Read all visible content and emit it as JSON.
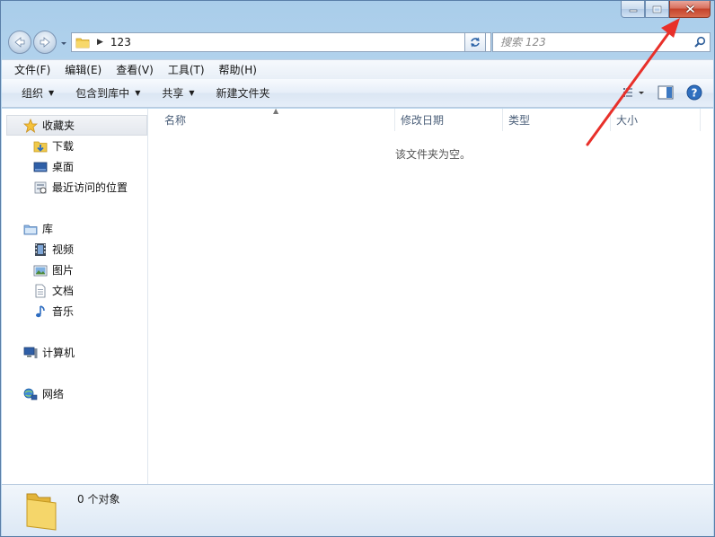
{
  "window": {
    "caption_buttons": [
      "minimize-icon",
      "maximize-icon",
      "close-icon"
    ]
  },
  "address_bar": {
    "path": "123"
  },
  "search": {
    "placeholder": "搜索 123"
  },
  "menu": {
    "items": [
      {
        "label": "文件(F)"
      },
      {
        "label": "编辑(E)"
      },
      {
        "label": "查看(V)"
      },
      {
        "label": "工具(T)"
      },
      {
        "label": "帮助(H)"
      }
    ]
  },
  "toolbar": {
    "organize": "组织",
    "include_in_library": "包含到库中",
    "share": "共享",
    "new_folder": "新建文件夹"
  },
  "sidebar": {
    "favorites": {
      "label": "收藏夹",
      "items": [
        {
          "label": "下载"
        },
        {
          "label": "桌面"
        },
        {
          "label": "最近访问的位置"
        }
      ]
    },
    "libraries": {
      "label": "库",
      "items": [
        {
          "label": "视频"
        },
        {
          "label": "图片"
        },
        {
          "label": "文档"
        },
        {
          "label": "音乐"
        }
      ]
    },
    "computer": {
      "label": "计算机"
    },
    "network": {
      "label": "网络"
    }
  },
  "file_list": {
    "columns": [
      {
        "label": "名称"
      },
      {
        "label": "修改日期"
      },
      {
        "label": "类型"
      },
      {
        "label": "大小"
      }
    ],
    "empty_message": "该文件夹为空。"
  },
  "details_pane": {
    "item_count": "0 个对象"
  },
  "colors": {
    "accent": "#3a6ea5",
    "close_button": "#c5422b",
    "annotation_arrow": "#e8302a"
  }
}
